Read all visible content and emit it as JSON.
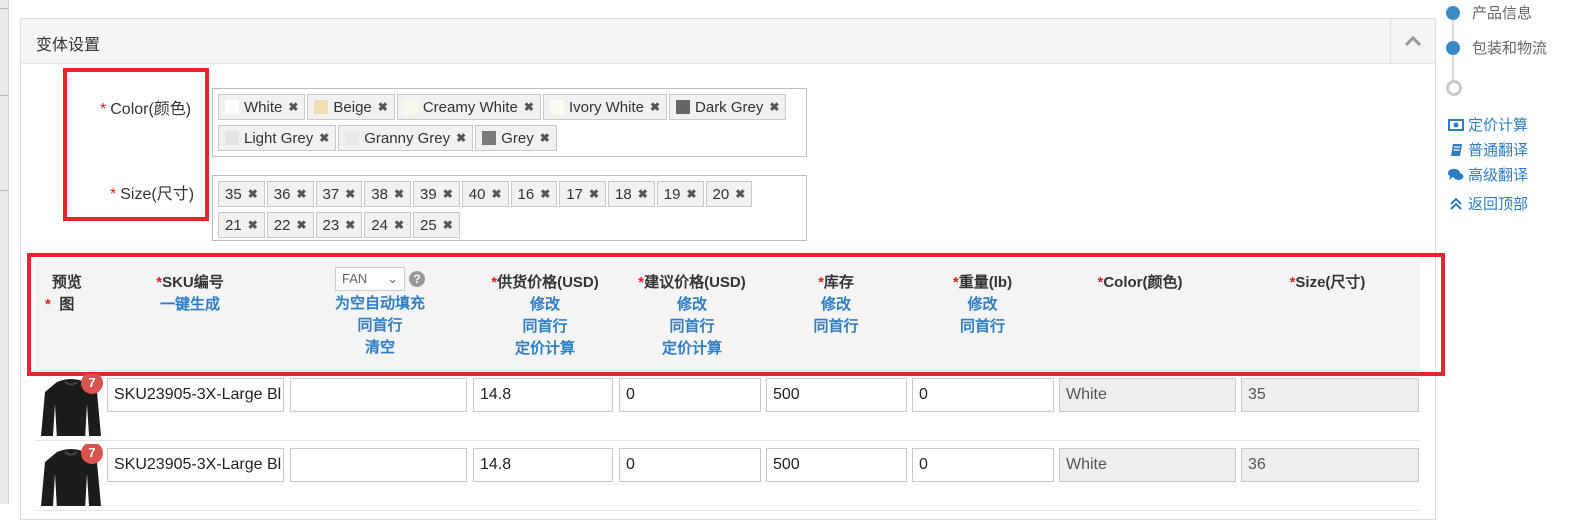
{
  "panel": {
    "title": "变体设置"
  },
  "attributes": {
    "color": {
      "label": "Color(颜色)",
      "star": "*",
      "tags": [
        {
          "name": "White",
          "color": "#ffffff"
        },
        {
          "name": "Beige",
          "color": "#efdfb0"
        },
        {
          "name": "Creamy White",
          "color": "#fbf7e8"
        },
        {
          "name": "Ivory White",
          "color": "#fdfbee"
        },
        {
          "name": "Dark Grey",
          "color": "#666666"
        },
        {
          "name": "Light Grey",
          "color": "#e3e3e3"
        },
        {
          "name": "Granny Grey",
          "color": "#e8e8e8"
        },
        {
          "name": "Grey",
          "color": "#7a7a7a"
        }
      ]
    },
    "size": {
      "label": "Size(尺寸)",
      "star": "*",
      "tags": [
        "35",
        "36",
        "37",
        "38",
        "39",
        "40",
        "16",
        "17",
        "18",
        "19",
        "20",
        "21",
        "22",
        "23",
        "24",
        "25"
      ]
    }
  },
  "table_header": {
    "preview": {
      "star": "*",
      "label": "预览图"
    },
    "sku": {
      "star": "*",
      "label": "SKU编号",
      "link": "一键生成"
    },
    "fan": {
      "select": "FAN",
      "help": "?",
      "links": [
        "为空自动填充",
        "同首行",
        "清空"
      ]
    },
    "supply_price": {
      "star": "*",
      "label": "供货价格(USD)",
      "links": [
        "修改",
        "同首行",
        "定价计算"
      ]
    },
    "suggest_price": {
      "star": "*",
      "label": "建议价格(USD)",
      "links": [
        "修改",
        "同首行",
        "定价计算"
      ]
    },
    "stock": {
      "star": "*",
      "label": "库存",
      "links": [
        "修改",
        "同首行"
      ]
    },
    "weight": {
      "star": "*",
      "label": "重量(lb)",
      "links": [
        "修改",
        "同首行"
      ]
    },
    "color": {
      "star": "*",
      "label": "Color(颜色)"
    },
    "size": {
      "star": "*",
      "label": "Size(尺寸)"
    }
  },
  "rows": [
    {
      "badge": "7",
      "sku": "SKU23905-3X-Large Bl",
      "fan": "",
      "supply": "14.8",
      "suggest": "0",
      "stock": "500",
      "weight": "0",
      "color": "White",
      "size": "35"
    },
    {
      "badge": "7",
      "sku": "SKU23905-3X-Large Bl",
      "fan": "",
      "supply": "14.8",
      "suggest": "0",
      "stock": "500",
      "weight": "0",
      "color": "White",
      "size": "36"
    }
  ],
  "sidebar": {
    "steps": [
      "产品信息",
      "包装和物流"
    ],
    "tools": [
      {
        "label": "定价计算",
        "icon": "money-icon"
      },
      {
        "label": "普通翻译",
        "icon": "book-icon"
      },
      {
        "label": "高级翻译",
        "icon": "comments-icon"
      },
      {
        "label": "返回顶部",
        "icon": "double-chevron-up-icon"
      }
    ]
  }
}
